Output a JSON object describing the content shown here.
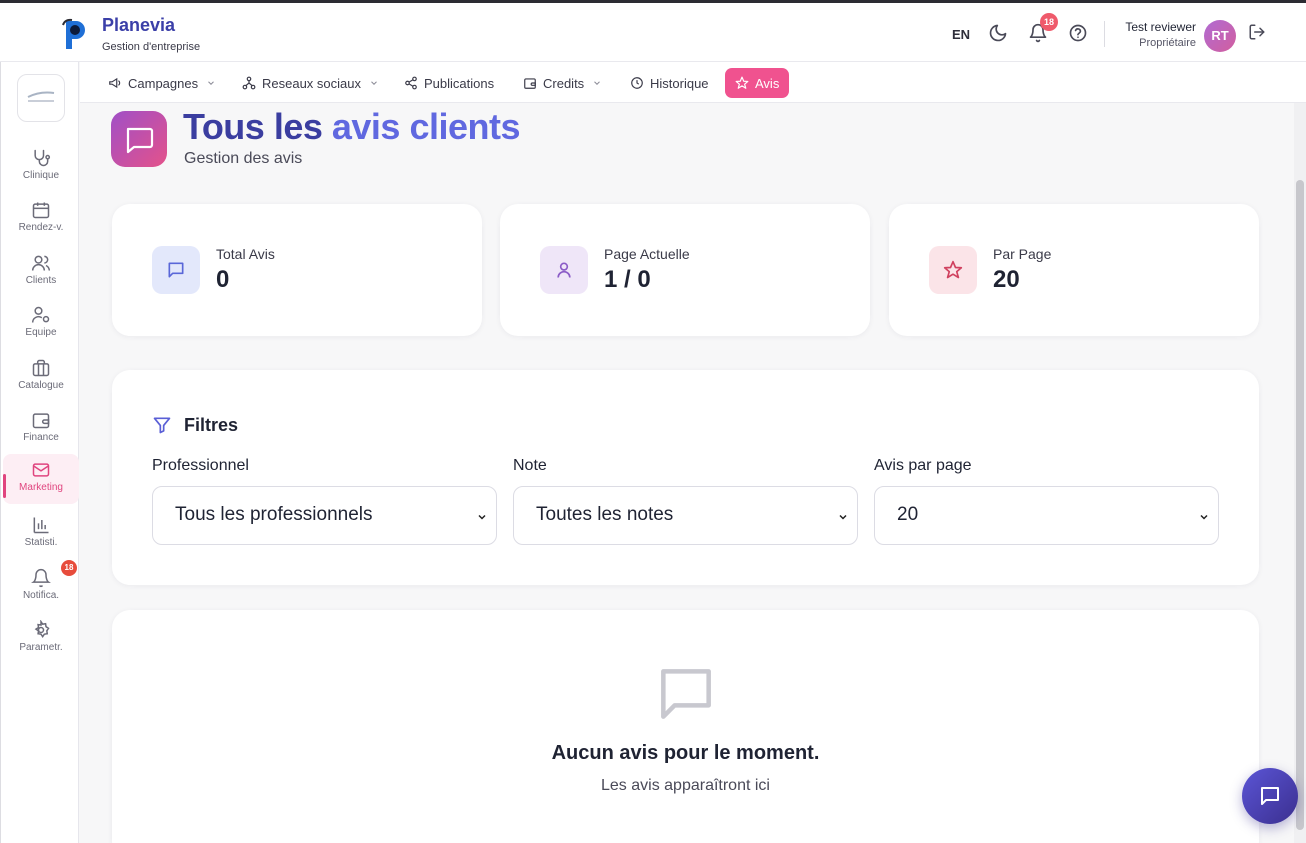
{
  "app": {
    "brand_name": "Planevia",
    "brand_subtitle": "Gestion d'entreprise",
    "language": "EN",
    "notifications_count": "18",
    "user_name": "Test reviewer",
    "user_role": "Propriétaire",
    "user_initials": "RT"
  },
  "sidebar": {
    "items": [
      {
        "label": "Clinique",
        "icon": "stethoscope-icon"
      },
      {
        "label": "Rendez-v.",
        "icon": "calendar-icon"
      },
      {
        "label": "Clients",
        "icon": "users-icon"
      },
      {
        "label": "Equipe",
        "icon": "user-cog-icon"
      },
      {
        "label": "Catalogue",
        "icon": "briefcase-icon"
      },
      {
        "label": "Finance",
        "icon": "wallet-icon"
      },
      {
        "label": "Marketing",
        "icon": "mail-icon",
        "active": true
      },
      {
        "label": "Statisti.",
        "icon": "bar-chart-icon"
      },
      {
        "label": "Notifica.",
        "icon": "bell-icon",
        "badge": "18"
      },
      {
        "label": "Parametr.",
        "icon": "gear-icon"
      }
    ]
  },
  "topnav": {
    "items": [
      {
        "label": "Campagnes",
        "icon": "megaphone-icon",
        "dropdown": true
      },
      {
        "label": "Reseaux sociaux",
        "icon": "network-icon",
        "dropdown": true
      },
      {
        "label": "Publications",
        "icon": "share-icon",
        "dropdown": false
      },
      {
        "label": "Credits",
        "icon": "wallet-icon",
        "dropdown": true
      },
      {
        "label": "Historique",
        "icon": "clock-icon",
        "dropdown": false
      },
      {
        "label": "Avis",
        "icon": "star-icon",
        "dropdown": false,
        "active": true
      }
    ]
  },
  "page": {
    "title_part1": "Tous les ",
    "title_part2": "avis clients",
    "subtitle": "Gestion des avis"
  },
  "stats": [
    {
      "label": "Total Avis",
      "value": "0",
      "icon": "message-icon",
      "color": "#5a67d8"
    },
    {
      "label": "Page Actuelle",
      "value": "1 / 0",
      "icon": "user-icon",
      "color": "#8b5cc7"
    },
    {
      "label": "Par Page",
      "value": "20",
      "icon": "star-icon",
      "color": "#d0415f"
    }
  ],
  "filters": {
    "title": "Filtres",
    "professional_label": "Professionnel",
    "professional_value": "Tous les professionnels",
    "rating_label": "Note",
    "rating_value": "Toutes les notes",
    "per_page_label": "Avis par page",
    "per_page_value": "20"
  },
  "empty_state": {
    "title": "Aucun avis pour le moment.",
    "subtitle": "Les avis apparaîtront ici"
  },
  "colors": {
    "accent_pink": "#f0528f",
    "brand_indigo": "#3b3fa8"
  }
}
